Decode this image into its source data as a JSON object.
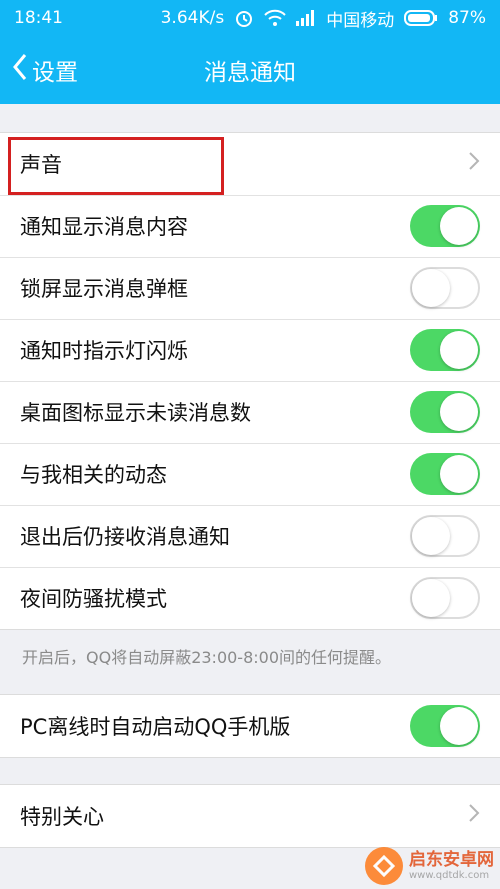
{
  "status": {
    "time": "18:41",
    "speed": "3.64K/s",
    "carrier": "中国移动",
    "battery": "87%"
  },
  "nav": {
    "back_label": "设置",
    "title": "消息通知"
  },
  "rows": [
    {
      "label": "声音",
      "type": "link"
    },
    {
      "label": "通知显示消息内容",
      "type": "toggle",
      "on": true
    },
    {
      "label": "锁屏显示消息弹框",
      "type": "toggle",
      "on": false
    },
    {
      "label": "通知时指示灯闪烁",
      "type": "toggle",
      "on": true
    },
    {
      "label": "桌面图标显示未读消息数",
      "type": "toggle",
      "on": true
    },
    {
      "label": "与我相关的动态",
      "type": "toggle",
      "on": true
    },
    {
      "label": "退出后仍接收消息通知",
      "type": "toggle",
      "on": false
    },
    {
      "label": "夜间防骚扰模式",
      "type": "toggle",
      "on": false
    }
  ],
  "hint": "开启后，QQ将自动屏蔽23:00-8:00间的任何提醒。",
  "pc_row": {
    "label": "PC离线时自动启动QQ手机版",
    "on": true
  },
  "special_row": {
    "label": "特别关心"
  },
  "watermark": {
    "name": "启东安卓网",
    "url": "www.qdtdk.com"
  },
  "colors": {
    "accent": "#12b7f5",
    "toggle_on": "#4cd865",
    "highlight": "#d42020"
  }
}
